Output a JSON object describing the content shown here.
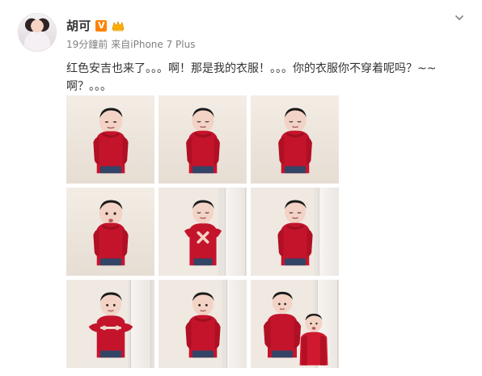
{
  "post": {
    "author": "胡可",
    "verified_badge": "V",
    "meta_time": "19分鐘前",
    "meta_source": "来自iPhone 7 Plus",
    "content": "红色安吉也来了。。。啊！那是我的衣服！。。。你的衣服你不穿着呢吗？~~\n啊？。。。"
  },
  "icons": {
    "avatar": "avatar",
    "verified": "verified-icon",
    "crown": "crown-icon",
    "dropdown": "chevron-down-icon"
  },
  "gallery": {
    "photos": [
      {
        "name": "photo-1"
      },
      {
        "name": "photo-2"
      },
      {
        "name": "photo-3"
      },
      {
        "name": "photo-4"
      },
      {
        "name": "photo-5"
      },
      {
        "name": "photo-6"
      },
      {
        "name": "photo-7"
      },
      {
        "name": "photo-8"
      },
      {
        "name": "photo-9"
      }
    ]
  },
  "colors": {
    "accent": "#ff8200",
    "text": "#333333",
    "muted": "#808080",
    "sweater": "#c4142c"
  }
}
